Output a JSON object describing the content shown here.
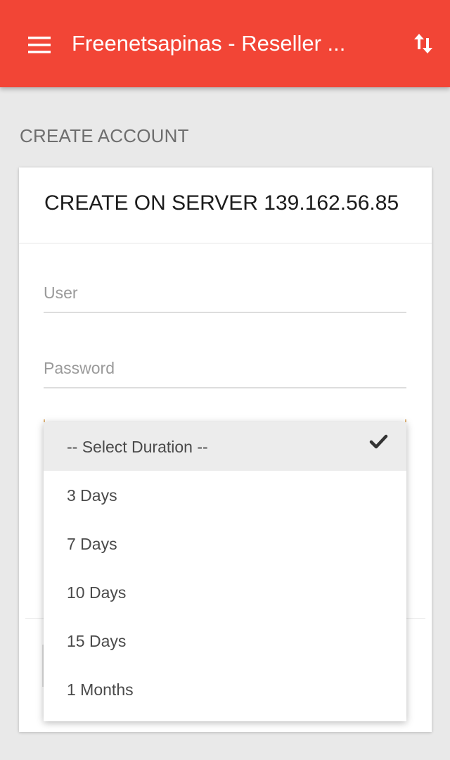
{
  "app_bar": {
    "title": "Freenetsapinas - Reseller ...",
    "menu_icon": "hamburger-menu-icon",
    "action_icon": "swap-vertical-arrows-icon",
    "color": "#f24536"
  },
  "page": {
    "section_title": "CREATE ACCOUNT"
  },
  "card": {
    "title": "CREATE ON SERVER 139.162.56.85",
    "user_field": {
      "value": "",
      "placeholder": "User"
    },
    "password_field": {
      "value": "",
      "placeholder": "Password"
    },
    "duration_select": {
      "selected": "-- Select Duration --",
      "accent_color": "#e0b57a"
    }
  },
  "dropdown": {
    "options": [
      {
        "label": "-- Select Duration --",
        "selected": true
      },
      {
        "label": "3 Days",
        "selected": false
      },
      {
        "label": "7 Days",
        "selected": false
      },
      {
        "label": "10 Days",
        "selected": false
      },
      {
        "label": "15 Days",
        "selected": false
      },
      {
        "label": "1 Months",
        "selected": false
      }
    ],
    "check_icon": "checkmark-icon"
  }
}
